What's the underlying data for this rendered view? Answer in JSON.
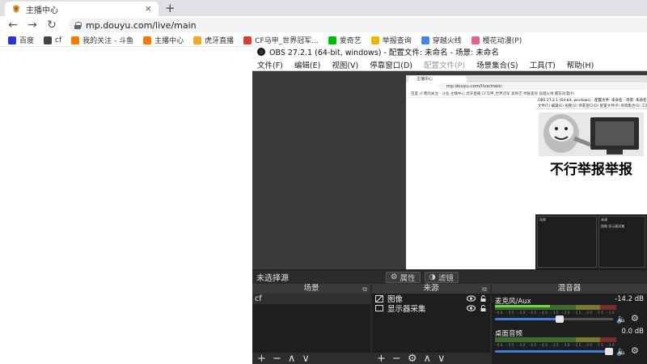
{
  "browser": {
    "tab_title": "主播中心",
    "tab_close": "×",
    "new_tab": "+",
    "nav": {
      "back": "←",
      "forward": "→",
      "reload": "↻"
    },
    "url": "mp.douyu.com/live/main",
    "bookmarks": [
      {
        "label": "百度",
        "icon": "baidu-icon",
        "color": "#2932e1"
      },
      {
        "label": "cf",
        "icon": "cf-icon",
        "color": "#444444"
      },
      {
        "label": "我的关注 - 斗鱼",
        "icon": "douyu-icon",
        "color": "#ff7700"
      },
      {
        "label": "主播中心",
        "icon": "douyu-icon",
        "color": "#ff7700"
      },
      {
        "label": "虎牙直播",
        "icon": "huya-icon",
        "color": "#f5a623"
      },
      {
        "label": "CF马甲_世界冠军...",
        "icon": "cf-red-icon",
        "color": "#e03c31"
      },
      {
        "label": "爱奇艺",
        "icon": "iqiyi-icon",
        "color": "#00be06"
      },
      {
        "label": "举报查询",
        "icon": "report-icon",
        "color": "#f0b400"
      },
      {
        "label": "穿越火线",
        "icon": "chrome-icon",
        "color": "#4285f4"
      },
      {
        "label": "樱花动漫(P)",
        "icon": "sakura-icon",
        "color": "#e8618c"
      }
    ]
  },
  "obs": {
    "title": "OBS 27.2.1 (64-bit, windows) - 配置文件: 未命名 - 场景: 未命名",
    "menu": [
      "文件(F)",
      "编辑(E)",
      "视图(V)",
      "停靠窗口(D)",
      "配置文件(P)",
      "场景集合(S)",
      "工具(T)",
      "帮助(H)"
    ],
    "no_source": "未选择源",
    "properties_btn": "属性",
    "filters_btn": "滤镜",
    "scenes": {
      "title": "场景",
      "items": [
        "cf"
      ]
    },
    "sources": {
      "title": "来源",
      "items": [
        {
          "label": "图像",
          "icon": "image-icon"
        },
        {
          "label": "显示器采集",
          "icon": "monitor-icon"
        }
      ]
    },
    "mixer": {
      "title": "混音器",
      "channels": [
        {
          "name": "麦克风/Aux",
          "db": "-14.2 dB",
          "level": 0.45,
          "volume": 0.55
        },
        {
          "name": "桌面音频",
          "db": "0.0 dB",
          "level": 0.0,
          "volume": 1.0
        }
      ],
      "ticks": "-60 -55 -50 -45 -40 -35 -30 -25 -20 -15 -10 -5 0"
    },
    "footer_icons": {
      "add": "+",
      "remove": "−",
      "up": "∧",
      "down": "∨",
      "settings": "⚙"
    }
  },
  "nested_preview": {
    "tab_title": "主播中心",
    "url": "mp.douyu.com/live/main",
    "bookmarks_line": "百度   cf   我的关注 - 斗鱼   主播中心   虎牙直播   CF马甲_世界冠军   爱奇艺   举报查询   穿越火线   樱花动漫(P)",
    "obs_title": "OBS 27.2.1 (64-bit, windows) - 配置文件: 未命名 - 场景: 未命名",
    "obs_menu": "文件(F) 编辑(E) 视图(V) 停靠窗口(D) 配置文件(P) 场景集合(S) 工具(T) 帮助(H)",
    "meme_caption": "不行举报举报",
    "scenes_label": "场景",
    "sources_label": "来源",
    "source_items": "图像  显示器采集"
  }
}
